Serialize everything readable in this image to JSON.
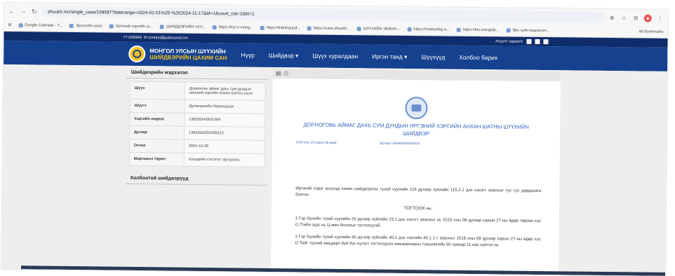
{
  "browser": {
    "url": "shuukh.mn/single_case/159587?daterange=2024-01-01%20-%202024-11-17&id=1&court_cat=1&bt=1",
    "bookmarks": [
      "Google Calendar - T...",
      "Эрүүгийн шүүх",
      "Иргэний хэргийн ш...",
      "ШИЙДВЭРИЙН ХУУ...",
      "https://erp.e-mong...",
      "https://training.jud...",
      "https://case.shuukh...",
      "ШҮҮХИЙН ЭМБИХ...",
      "https://medsulleg.is...",
      "https://bio.mongolp...",
      "Эрх зүйн мэдээлэл..."
    ],
    "all_bookmarks": "All Bookmarks"
  },
  "site": {
    "phone": "77-556949",
    "email": "contact@judcouncil.mn",
    "contact_right": "Асуулт хариулт",
    "brand_line1": "МОНГОЛ УЛСЫН ШҮҮХИЙН",
    "brand_line2": "ШИЙДВЭРИЙН ЦАХИМ САН",
    "menu": [
      "Нүүр",
      "Шийдвэр ▾",
      "Шүүх хуралдаан",
      "Иргэн танд ▾",
      "Шүүхүүд",
      "Холбоо барих"
    ]
  },
  "sidebar": {
    "title": "Шийдвэрийн мэдээлэл",
    "rows": [
      {
        "k": "Шүүх",
        "v": "Дорноговь аймаг дахь сум дундын иргэний хэргийн анхан шатны шүүх"
      },
      {
        "k": "Шүүгч",
        "v": "Дулжиржийн Наранцэцэг"
      },
      {
        "k": "Хэргийн индекс",
        "v": "136/2024/00319/И"
      },
      {
        "k": "Дугаар",
        "v": "136/ШШ2024/00412"
      },
      {
        "k": "Огноо",
        "v": "2024-10-28"
      },
      {
        "k": "Маргааны төрөл",
        "v": "Хүүхдийн тэтгэлэг гаргуулах,"
      }
    ],
    "related_title": "Холбоотой шийдвэрүүд"
  },
  "document": {
    "title": "ДОРНОГОВЬ АЙМАГ ДАХЬ СУМ ДУНДЫН ИРГЭНИЙ ХЭРГИЙН АНХАН ШАТНЫ ШҮҮХИЙН ШИЙДВЭР",
    "date": "2024 оны 10 сарын 28 өдөр",
    "number": "Дугаар 136/ШШ2024/00412",
    "intro": "Иргэний хэрэг шүүхэд хянан шийдвэрлэх тухай хуулийн 115 дугаар зүйлийн 115.2.1 дэх хэсэгт заасныг тус тус удирдлага болгон",
    "heading": "ТОГТООХ нь:",
    "p1": "1.Гэр бүлийн тухай хуулийн 23 дугаар зүйлийн 23.1 дэх хэсэгт заасныг нь 2015 оны 08 дугаар сарын 27-ны өдөр төрсөн хүү О.Тгийн эцэг нь Ц мөн болохыг тогтоосугай.",
    "p2": "2.Гэр бүлийн тухай хуулийн 40 дүгээр зүйлийн 40.1 дэх хэсгийн 40.1.1-т заасныг 2015 оны 08 дугаар сарын 27-ны өдөр хүү О.Тийг түүний амьдарч буй бүс нутагт тогтоогдсон амьжиргааны түвшингийн 50 хувиар 11 нас хүртэл нь"
  }
}
